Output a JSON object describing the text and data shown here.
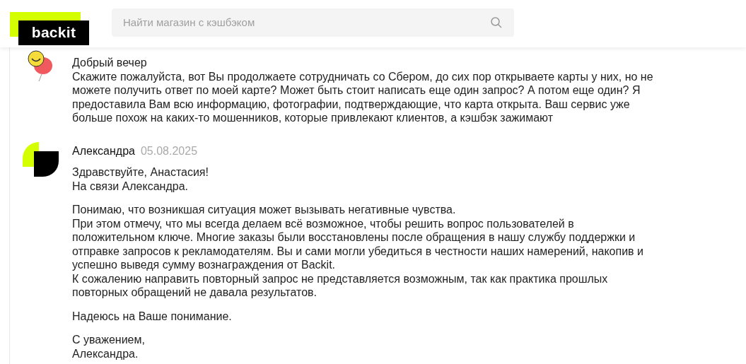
{
  "header": {
    "logo": "backit",
    "search": {
      "placeholder": "Найти магазин с кэшбэком"
    }
  },
  "comments": [
    {
      "kind": "balloon",
      "paragraphs": [
        [
          "Добрый вечер",
          "Скажите пожалуйста, вот Вы продолжаете сотрудничать со Сбером, до сих пор открываете карты у них, но не",
          "можете получить ответ по моей карте? Может быть стоит написать еще один запрос? А потом еще один? Я",
          "предоставила Вам всю информацию, фотографии, подтверждающие, что карта открыта. Ваш сервис уже",
          "больше похож на каких-то мошенников, которые привлекают клиентов, а кэшбэк зажимают"
        ]
      ]
    },
    {
      "kind": "brand",
      "author": "Александра",
      "date": "05.08.2025",
      "paragraphs": [
        [
          "Здравствуйте, Анастасия!",
          "На связи Александра."
        ],
        [
          "Понимаю, что возникшая ситуация может вызывать негативные чувства.",
          "При этом отмечу, что мы всегда делаем всё возможное, чтобы решить вопрос пользователей в",
          "положительном ключе. Многие заказы были восстановлены после обращения в нашу службу поддержки и",
          "отправке запросов к рекламодателям. Вы и сами могли убедиться в честности наших намерений, накопив и",
          "успешно выведя сумму вознаграждения от Backit.",
          "К сожалению направить повторный запрос не представляется возможным, так как практика прошлых",
          "повторных обращений не давала результатов."
        ],
        [
          "Надеюсь на Ваше понимание."
        ],
        [
          "С уважением,",
          "Александра."
        ]
      ]
    }
  ]
}
